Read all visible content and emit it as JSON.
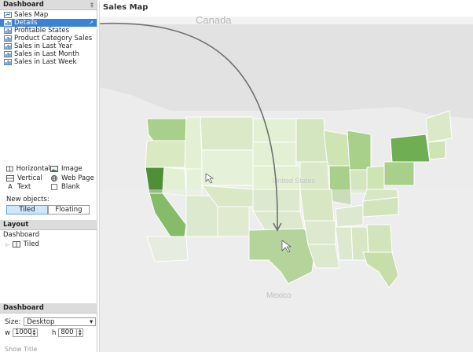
{
  "left_pane": {
    "header": "Dashboard",
    "pin": "‡",
    "sheets": [
      {
        "label": "Sales Map"
      },
      {
        "label": "Details",
        "goto": "Go to sheet"
      },
      {
        "label": "Profitable States"
      },
      {
        "label": "Product Category Sales"
      },
      {
        "label": "Sales in Last Year"
      },
      {
        "label": "Sales in Last Month"
      },
      {
        "label": "Sales in Last Week"
      }
    ],
    "objects": {
      "horizontal": "Horizontal",
      "image": "Image",
      "vertical": "Vertical",
      "web_page": "Web Page",
      "text": "Text",
      "blank": "Blank",
      "new_objects_label": "New objects:",
      "tiled": "Tiled",
      "floating": "Floating"
    },
    "layout": {
      "header": "Layout",
      "root": "Dashboard",
      "child": "Tiled"
    },
    "dashboard_section": {
      "header": "Dashboard",
      "size_label": "Size:",
      "size_value": "Desktop",
      "w_label": "w",
      "w_value": "1000",
      "h_label": "h",
      "h_value": "800",
      "cutoff": "Show Title"
    }
  },
  "dashboard": {
    "title": "Sales Map",
    "map_labels": {
      "canada": "Canada",
      "united_states": "United States",
      "mexico": "Mexico"
    }
  },
  "colors": {
    "accent": "#3b82d6",
    "green_dark": "#3f8a2f",
    "green_mid": "#7fbd5f",
    "green_light": "#cfe4b3",
    "green_pale": "#e3f0d3"
  }
}
